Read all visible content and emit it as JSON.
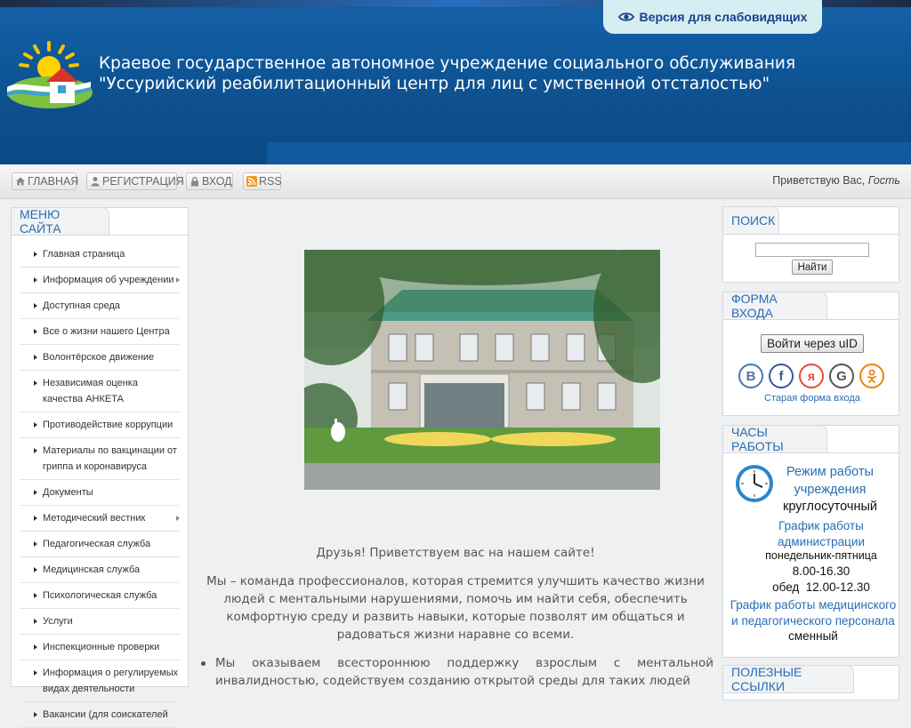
{
  "header": {
    "access_label": "Версия для слабовидящих",
    "title_line1": "Краевое государственное автономное учреждение социального обслуживания",
    "title_line2": "\"Уссурийский реабилитационный центр для лиц с умственной отсталостью\""
  },
  "nav": {
    "home": "ГЛАВНАЯ",
    "register": "РЕГИСТРАЦИЯ",
    "login": "ВХОД",
    "rss": "RSS",
    "greeting_prefix": "Приветствую Вас,",
    "greeting_user": "Гость"
  },
  "menu": {
    "title": "МЕНЮ САЙТА",
    "items": [
      {
        "label": "Главная страница"
      },
      {
        "label": "Информация об учреждении"
      },
      {
        "label": "Доступная среда"
      },
      {
        "label": "Все о жизни нашего Центра"
      },
      {
        "label": "Волонтёрское движение"
      },
      {
        "label": "Независимая оценка качества АНКЕТА"
      },
      {
        "label": "Противодействие коррупции"
      },
      {
        "label": "Материалы по вакцинации от гриппа и коронавируса"
      },
      {
        "label": "Документы"
      },
      {
        "label": "Методический вестник"
      },
      {
        "label": "Педагогическая служба"
      },
      {
        "label": "Медицинская служба"
      },
      {
        "label": "Психологическая служба"
      },
      {
        "label": "Услуги"
      },
      {
        "label": "Инспекционные проверки"
      },
      {
        "label": "Информация о регулируемых видах деятельности"
      },
      {
        "label": "Вакансии (для соискателей"
      }
    ]
  },
  "content": {
    "welcome": "Друзья! Приветствуем вас на нашем сайте!",
    "intro": "Мы – команда профессионалов, которая стремится улучшить качество жизни людей с ментальными нарушениями, помочь им найти себя, обеспечить комфортную среду и развить навыки, которые позволят им общаться и радоваться жизни наравне со всеми.",
    "bullet1": "Мы оказываем всестороннюю поддержку взрослым с ментальной инвалидностью, содействуем созданию открытой среды для таких людей"
  },
  "search": {
    "title": "ПОИСК",
    "button": "Найти",
    "value": ""
  },
  "login_form": {
    "title": "ФОРМА ВХОДА",
    "uid_button": "Войти через uID",
    "social": [
      "vk-icon",
      "facebook-icon",
      "yandex-icon",
      "google-icon",
      "odnoklassniki-icon"
    ],
    "old_form": "Старая форма входа"
  },
  "hours": {
    "title": "ЧАСЫ РАБОТЫ",
    "mode_title": "Режим работы учреждения",
    "mode_value": "круглосуточный",
    "admin_title": "График работы администрации",
    "admin_days": "понедельник-пятница",
    "admin_time": "8.00-16.30",
    "admin_lunch": "обед  12.00-12.30",
    "staff_title": "График работы медицинского и педагогического персонала",
    "staff_value": "сменный"
  },
  "links": {
    "title": "ПОЛЕЗНЫЕ ССЫЛКИ"
  },
  "colors": {
    "header_blue": "#0f5a9e",
    "link_blue": "#2a6db5",
    "access_bg": "#d6edf2"
  }
}
